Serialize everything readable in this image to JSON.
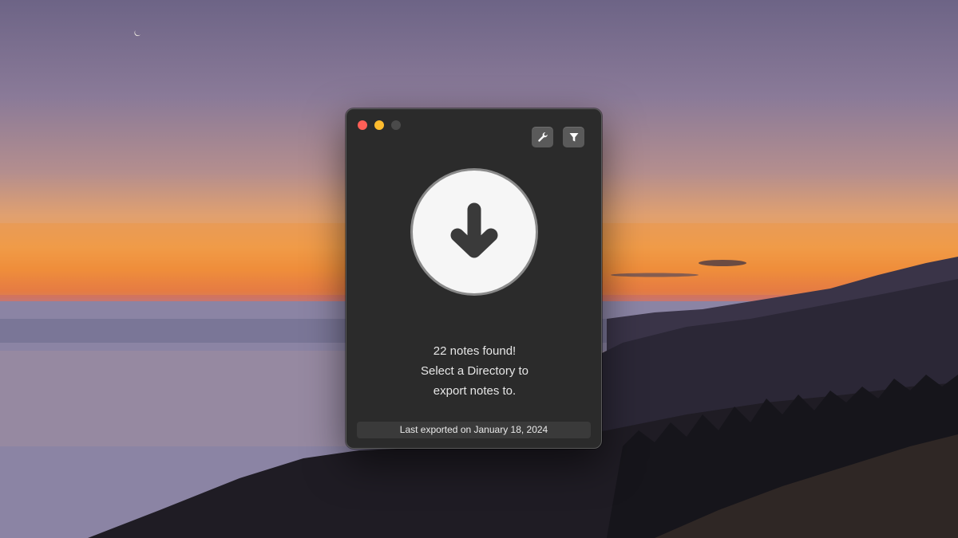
{
  "window": {
    "controls": [
      "close",
      "minimize",
      "zoom"
    ],
    "toolbar": {
      "settings_icon": "wrench-icon",
      "filter_icon": "filter-icon"
    },
    "export_icon": "arrow-down-icon",
    "message": {
      "line1": "22 notes found!",
      "line2": "Select a Directory to",
      "line3": "export notes to."
    },
    "status": "Last exported on January 18, 2024"
  },
  "colors": {
    "window_bg": "#2b2b2b",
    "close": "#fe5f57",
    "minimize": "#febc2e",
    "zoom_inactive": "#4a4a4a",
    "export_button": "#f6f6f6",
    "arrow": "#3a3a3a"
  }
}
